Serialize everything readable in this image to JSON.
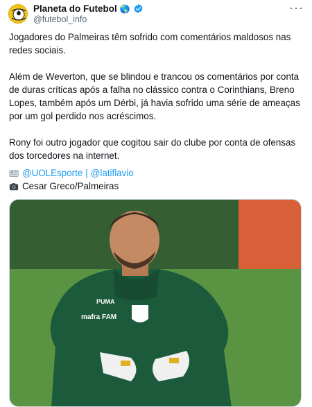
{
  "author": {
    "name": "Planeta do Futebol",
    "globe_emoji": "🌎",
    "handle": "@futebol_info",
    "verified": true
  },
  "more_label": "···",
  "body": {
    "p1": "Jogadores do Palmeiras têm sofrido com comentários maldosos nas redes sociais.",
    "p2": "Além de Weverton, que se blindou e trancou os comentários por conta de duras críticas após a falha no clássico contra o Corinthians, Breno Lopes, também após um Dérbi, já havia sofrido uma série de ameaças por um gol perdido nos acréscimos.",
    "p3": "Rony foi outro jogador que cogitou sair do clube por conta de ofensas dos torcedores na internet."
  },
  "credits": {
    "source_icon": "newspaper-icon",
    "source1": "@UOLEsporte",
    "separator": "|",
    "source2": "@latiflavio",
    "photo_icon": "camera-icon",
    "photo_credit": "Cesar Greco/Palmeiras"
  },
  "colors": {
    "link": "#1d9bf0",
    "verified": "#1d9bf0",
    "jacket": "#1c5a3c",
    "grass": "#4d8a3c"
  },
  "photo": {
    "jacket_text": "mafra FAM",
    "logo_text": "PUMA"
  }
}
